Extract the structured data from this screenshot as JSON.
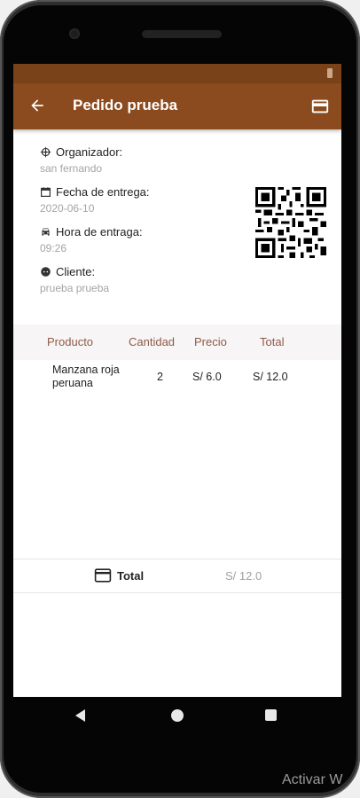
{
  "appbar": {
    "title": "Pedido prueba",
    "back_icon": "arrow-left-icon",
    "action_icon": "credit-card-icon"
  },
  "order_info": {
    "organizer": {
      "icon": "dharmachakra-icon",
      "label": "Organizador:",
      "value": "san fernando"
    },
    "delivery_date": {
      "icon": "calendar-icon",
      "label": "Fecha de entrega:",
      "value": "2020-06-10"
    },
    "delivery_time": {
      "icon": "car-icon",
      "label": "Hora de entraga:",
      "value": "09:26"
    },
    "client": {
      "icon": "face-icon",
      "label": "Cliente:",
      "value": "prueba prueba"
    }
  },
  "products_table": {
    "headers": [
      "Producto",
      "Cantidad",
      "Precio",
      "Total"
    ],
    "rows": [
      {
        "product_line1": "Manzana roja",
        "product_line2": "peruana",
        "quantity": "2",
        "price": "S/ 6.0",
        "total": "S/ 12.0"
      }
    ]
  },
  "summary": {
    "icon": "credit-card-icon",
    "label": "Total",
    "value": "S/ 12.0"
  },
  "navbar": {
    "icons": [
      "nav-back-icon",
      "nav-home-icon",
      "nav-recent-icon"
    ]
  },
  "watermark": "Activar W",
  "colors": {
    "appbar": "#8b4b1f",
    "statusbar": "#7a4219",
    "header_text": "#8e5a4a",
    "muted_text": "#a4a4a4"
  }
}
